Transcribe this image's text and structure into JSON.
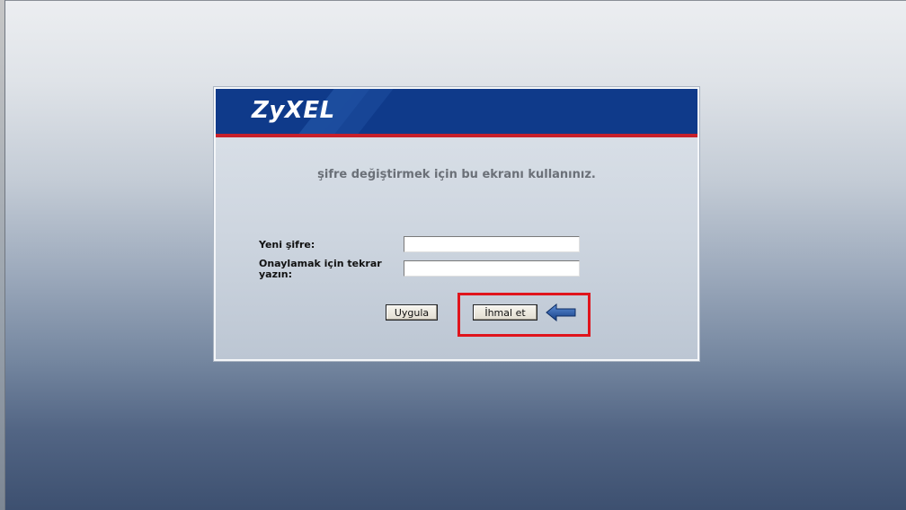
{
  "header": {
    "logo_text": "ZyXEL"
  },
  "instruction": "şifre değiştirmek için bu ekranı kullanınız.",
  "form": {
    "new_password_label": "Yeni şifre:",
    "confirm_password_label_line1": "Onaylamak için tekrar",
    "confirm_password_label_line2": "yazın:",
    "new_password_value": "",
    "confirm_password_value": ""
  },
  "buttons": {
    "apply_label": "Uygula",
    "ignore_label": "İhmal et"
  },
  "icons": {
    "arrow": "arrow-left-icon"
  },
  "colors": {
    "header_bg": "#0f3a8a",
    "header_accent": "#c8202a",
    "highlight": "#e0141c",
    "arrow": "#1f4f9c"
  }
}
